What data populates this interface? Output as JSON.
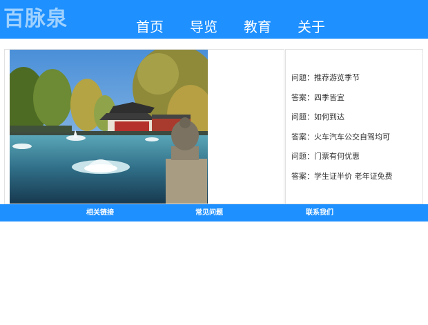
{
  "header": {
    "logo": "百脉泉",
    "nav": [
      "首页",
      "导览",
      "教育",
      "关于"
    ]
  },
  "main": {
    "photo_alt": "",
    "faq": [
      {
        "label": "问题：",
        "text": "推荐游览季节"
      },
      {
        "label": "答案：",
        "text": "四季皆宜"
      },
      {
        "label": "问题：",
        "text": "如何到达"
      },
      {
        "label": "答案：",
        "text": "火车汽车公交自驾均可"
      },
      {
        "label": "问题：",
        "text": "门票有何优惠"
      },
      {
        "label": "答案：",
        "text": "学生证半价 老年证免费"
      }
    ]
  },
  "footer": {
    "links": [
      "相关链接",
      "常见问题",
      "联系我们"
    ]
  },
  "colors": {
    "brand": "#1e90ff",
    "logo": "#9fd1ff",
    "text": "#333333"
  }
}
